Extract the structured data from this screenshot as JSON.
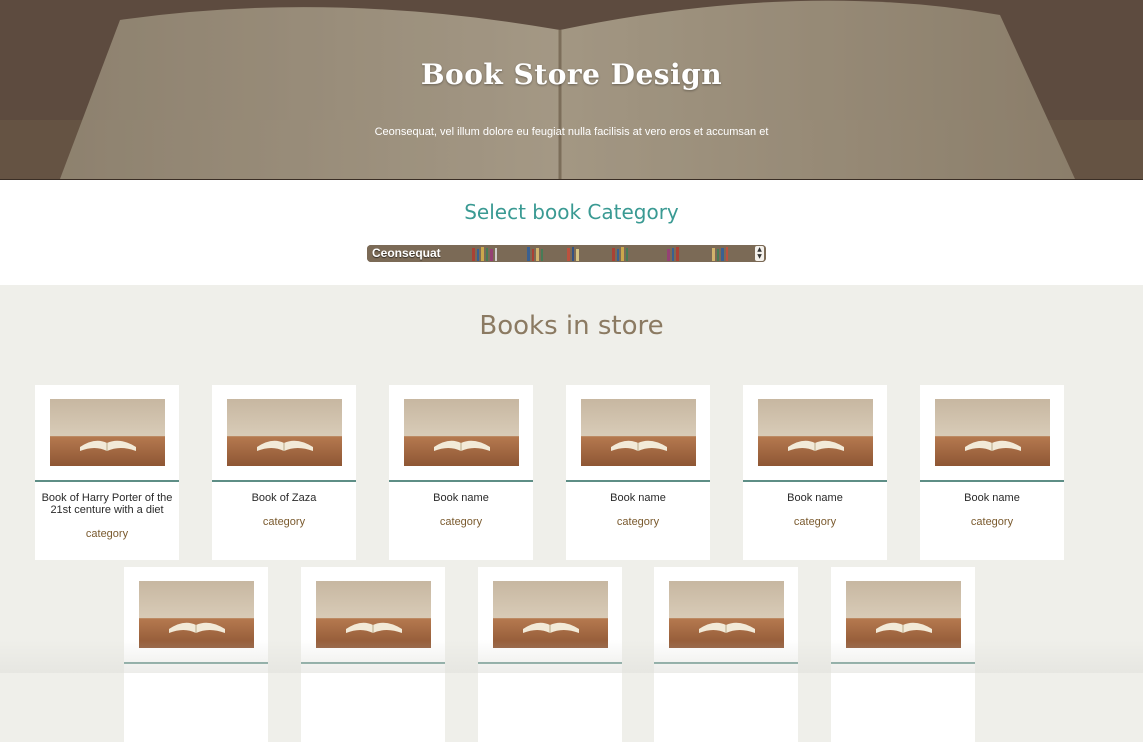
{
  "hero": {
    "title": "Book Store Design",
    "subtitle": "Ceonsequat, vel illum dolore eu feugiat nulla facilisis at vero eros et accumsan et"
  },
  "category_selector": {
    "heading": "Select book Category",
    "selected_value": "Ceonsequat"
  },
  "store": {
    "heading": "Books in store",
    "books": [
      {
        "name": "Book of Harry Porter of the 21st centure with a diet",
        "category": "category"
      },
      {
        "name": "Book of Zaza",
        "category": "category"
      },
      {
        "name": "Book name",
        "category": "category"
      },
      {
        "name": "Book name",
        "category": "category"
      },
      {
        "name": "Book name",
        "category": "category"
      },
      {
        "name": "Book name",
        "category": "category"
      },
      {
        "name": "",
        "category": ""
      },
      {
        "name": "",
        "category": ""
      },
      {
        "name": "",
        "category": ""
      },
      {
        "name": "",
        "category": ""
      },
      {
        "name": "",
        "category": ""
      }
    ]
  },
  "colors": {
    "accent_teal": "#3a9a93",
    "card_rule": "#5e8e86",
    "store_heading": "#8b7a62",
    "category_text": "#7a5a2e",
    "page_background": "#efefea"
  },
  "icons": {
    "book_thumbnail": "open-book-image",
    "select_arrows": "updown-arrows-icon"
  }
}
